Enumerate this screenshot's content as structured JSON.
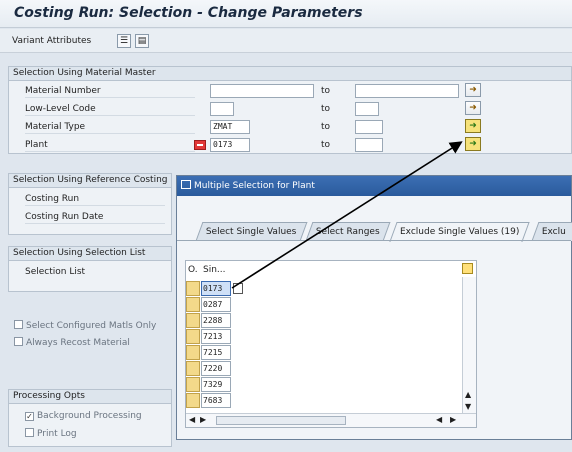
{
  "window": {
    "title": "Costing Run: Selection - Change Parameters"
  },
  "toolbar": {
    "variant_attributes": "Variant Attributes",
    "icons": [
      "structure-icon",
      "display-icon"
    ]
  },
  "material_master": {
    "title": "Selection Using Material Master",
    "to_label": "to",
    "rows": [
      {
        "label": "Material Number",
        "from": "",
        "to": ""
      },
      {
        "label": "Low-Level Code",
        "from": "",
        "to": ""
      },
      {
        "label": "Material Type",
        "from": "ZMAT",
        "to": ""
      },
      {
        "label": "Plant",
        "from": "0173",
        "to": ""
      }
    ]
  },
  "reference_costing": {
    "title": "Selection Using Reference Costing Run",
    "rows": [
      {
        "label": "Costing Run"
      },
      {
        "label": "Costing Run Date"
      }
    ]
  },
  "selection_list": {
    "title": "Selection Using Selection List",
    "label": "Selection List"
  },
  "options": {
    "select_configured": "Select Configured Matls Only",
    "always_recost": "Always Recost Material"
  },
  "processing": {
    "title": "Processing Opts",
    "background": {
      "label": "Background Processing",
      "checked": true
    },
    "print_log": {
      "label": "Print Log",
      "checked": false
    }
  },
  "popup": {
    "title": "Multiple Selection for Plant",
    "tabs": [
      {
        "label": "Select Single Values",
        "active": false
      },
      {
        "label": "Select Ranges",
        "active": false
      },
      {
        "label": "Exclude Single Values (19)",
        "active": true
      },
      {
        "label": "Exclu",
        "active": false
      }
    ],
    "grid": {
      "col_option": "O.",
      "col_value": "Sin...",
      "values": [
        "0173",
        "0287",
        "2288",
        "7213",
        "7215",
        "7220",
        "7329",
        "7683"
      ]
    }
  },
  "colors": {
    "title_blue": "#2a5a9c",
    "yellow_button": "#f6e27a",
    "arrow": "#000000"
  }
}
